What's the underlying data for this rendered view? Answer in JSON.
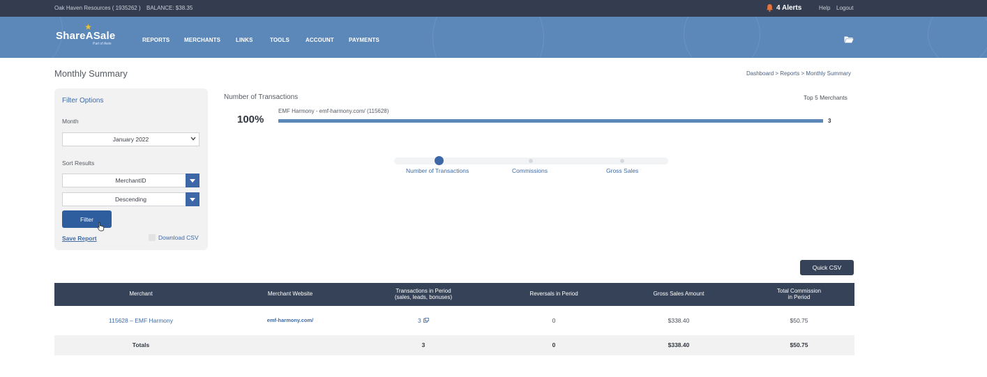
{
  "topbar": {
    "account": "Oak Haven Resources ( 1935262 )",
    "balance": "BALANCE: $38.35",
    "alerts": "4 Alerts",
    "help": "Help",
    "logout": "Logout"
  },
  "nav": {
    "logo": "ShareASale",
    "logo_sub": "Part of Awin",
    "items": [
      "REPORTS",
      "MERCHANTS",
      "LINKS",
      "TOOLS",
      "ACCOUNT",
      "PAYMENTS"
    ]
  },
  "page": {
    "title": "Monthly Summary",
    "breadcrumb": [
      "Dashboard",
      "Reports",
      "Monthly Summary"
    ],
    "breadcrumb_sep": " > "
  },
  "filter": {
    "title": "Filter Options",
    "month_label": "Month",
    "month_value": "January 2022",
    "sort_label": "Sort Results",
    "sort_by": "MerchantID",
    "sort_order": "Descending",
    "filter_button": "Filter",
    "save_report": "Save Report",
    "download_csv": "Download CSV"
  },
  "chart": {
    "title": "Number of Transactions",
    "top_label": "Top 5 Merchants",
    "percent": "100%",
    "bar_label": "EMF Harmony - emf-harmony.com/ (115628)",
    "bar_fraction": 1.0,
    "bar_value": "3",
    "tabs": [
      "Number of Transactions",
      "Commissions",
      "Gross Sales"
    ],
    "active_tab": 0
  },
  "quick_csv": "Quick CSV",
  "table": {
    "headers": [
      {
        "line1": "Merchant",
        "line2": ""
      },
      {
        "line1": "Merchant Website",
        "line2": ""
      },
      {
        "line1": "Transactions in Period",
        "line2": "(sales, leads, bonuses)"
      },
      {
        "line1": "Reversals in Period",
        "line2": ""
      },
      {
        "line1": "Gross Sales Amount",
        "line2": ""
      },
      {
        "line1": "Total Commission",
        "line2": "in Period"
      }
    ],
    "rows": [
      {
        "merchant": "115628 – EMF Harmony",
        "website": "emf-harmony.com/",
        "transactions": "3",
        "reversals": "0",
        "gross_sales": "$338.40",
        "commission": "$50.75"
      }
    ],
    "totals": {
      "label": "Totals",
      "transactions": "3",
      "reversals": "0",
      "gross_sales": "$338.40",
      "commission": "$50.75"
    }
  },
  "colors": {
    "topbar": "#333d4f",
    "nav": "#5b87b9",
    "accent": "#3d67a6",
    "table_header": "#364257"
  }
}
